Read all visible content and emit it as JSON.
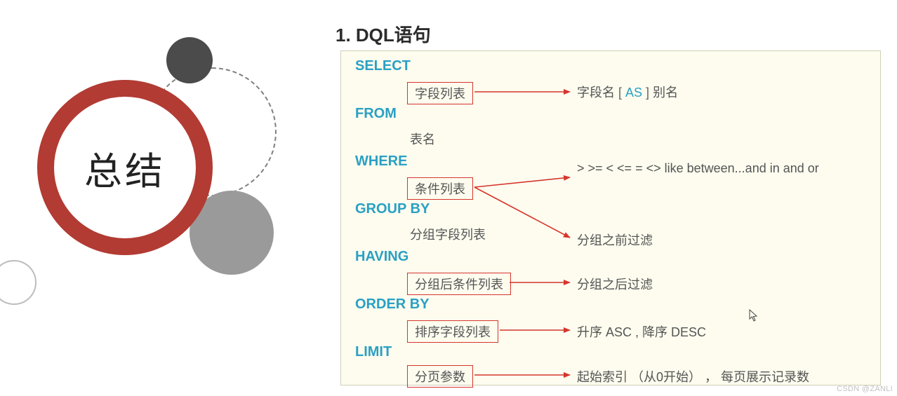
{
  "title": "1. DQL语句",
  "summary_circle": "总结",
  "watermark": "CSDN @ZANLI",
  "keywords": {
    "select": "SELECT",
    "from": "FROM",
    "where": "WHERE",
    "group_by": "GROUP  BY",
    "having": "HAVING",
    "order_by": "ORDER  BY",
    "limit": "LIMIT"
  },
  "boxes": {
    "fields": "字段列表",
    "conditions": "条件列表",
    "having_list": "分组后条件列表",
    "order_list": "排序字段列表",
    "page_params": "分页参数"
  },
  "subs": {
    "table_name": "表名",
    "group_fields": "分组字段列表"
  },
  "desc": {
    "fields": {
      "prefix": "字段名 ",
      "lb": "[ ",
      "as": "AS",
      "rb": " ]",
      "suffix": " 别名"
    },
    "where_ops": "> >= < <= = <>  like  between...and   in  and   or",
    "where_filter": "分组之前过滤",
    "having": "分组之后过滤",
    "order": "升序 ASC , 降序 DESC",
    "limit": "起始索引 （从0开始） ， 每页展示记录数"
  },
  "colors": {
    "keyword": "#2aa0c4",
    "box_border": "#d7352c",
    "arrow": "#d7352c",
    "panel_bg": "#fdfcef",
    "ring": "#b23b33"
  }
}
